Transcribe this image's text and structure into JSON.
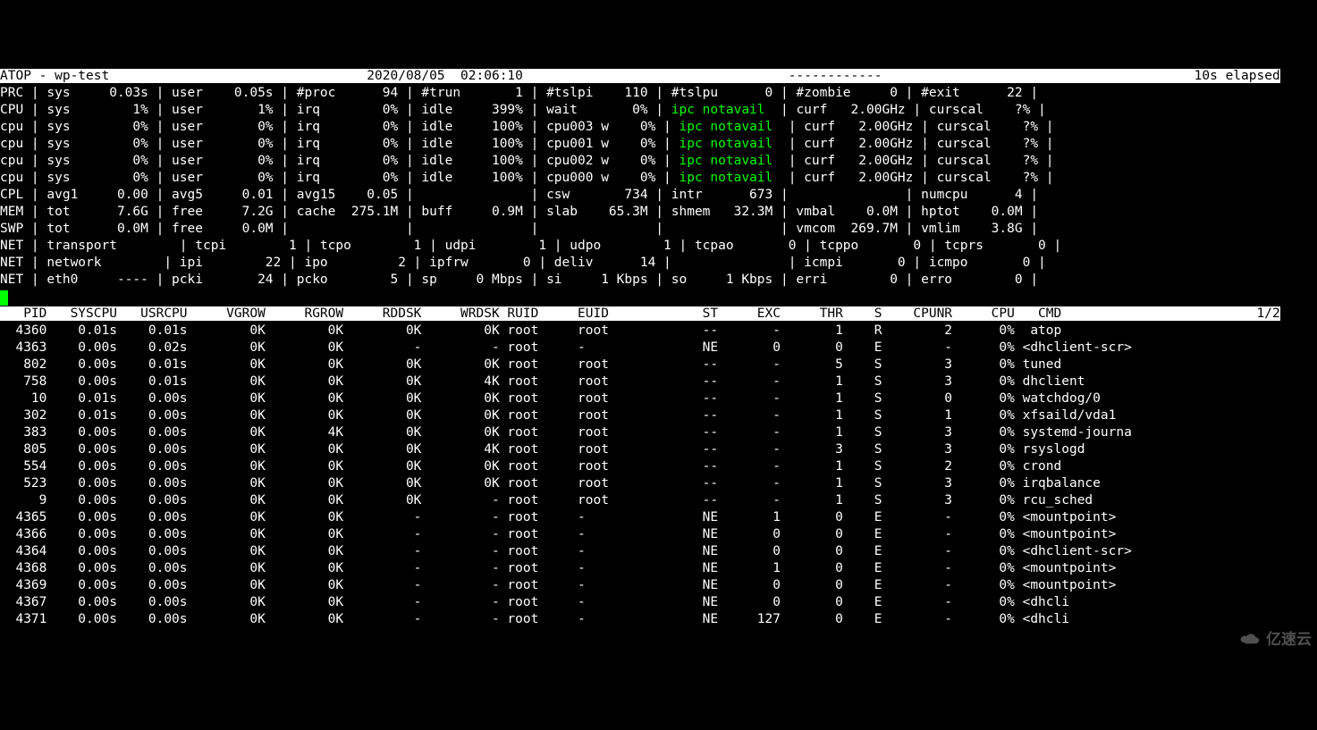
{
  "header": {
    "app": "ATOP",
    "host": "wp-test",
    "date": "2020/08/05",
    "time": "02:06:10",
    "dashes": "------------",
    "elapsed": "10s elapsed"
  },
  "sys_rows": [
    {
      "tag": "PRC",
      "cells": [
        [
          "sys",
          "0.03s"
        ],
        [
          "user",
          "0.05s"
        ],
        [
          "#proc",
          "94"
        ],
        [
          "#trun",
          "1"
        ],
        [
          "#tslpi",
          "110"
        ],
        [
          "#tslpu",
          "0"
        ],
        [
          "#zombie",
          "0"
        ],
        [
          "#exit",
          "22"
        ]
      ]
    },
    {
      "tag": "CPU",
      "cells": [
        [
          "sys",
          "1%"
        ],
        [
          "user",
          "1%"
        ],
        [
          "irq",
          "0%"
        ],
        [
          "idle",
          "399%"
        ],
        [
          "wait",
          "0%"
        ],
        [
          "ipc notavail",
          "",
          "grn"
        ],
        [
          "curf",
          "2.00GHz"
        ],
        [
          "curscal",
          "?%"
        ]
      ]
    },
    {
      "tag": "cpu",
      "cells": [
        [
          "sys",
          "0%"
        ],
        [
          "user",
          "0%"
        ],
        [
          "irq",
          "0%"
        ],
        [
          "idle",
          "100%"
        ],
        [
          "cpu003 w",
          "0%"
        ],
        [
          "ipc notavail",
          "",
          "grn"
        ],
        [
          "curf",
          "2.00GHz"
        ],
        [
          "curscal",
          "?%"
        ]
      ]
    },
    {
      "tag": "cpu",
      "cells": [
        [
          "sys",
          "0%"
        ],
        [
          "user",
          "0%"
        ],
        [
          "irq",
          "0%"
        ],
        [
          "idle",
          "100%"
        ],
        [
          "cpu001 w",
          "0%"
        ],
        [
          "ipc notavail",
          "",
          "grn"
        ],
        [
          "curf",
          "2.00GHz"
        ],
        [
          "curscal",
          "?%"
        ]
      ]
    },
    {
      "tag": "cpu",
      "cells": [
        [
          "sys",
          "0%"
        ],
        [
          "user",
          "0%"
        ],
        [
          "irq",
          "0%"
        ],
        [
          "idle",
          "100%"
        ],
        [
          "cpu002 w",
          "0%"
        ],
        [
          "ipc notavail",
          "",
          "grn"
        ],
        [
          "curf",
          "2.00GHz"
        ],
        [
          "curscal",
          "?%"
        ]
      ]
    },
    {
      "tag": "cpu",
      "cells": [
        [
          "sys",
          "0%"
        ],
        [
          "user",
          "0%"
        ],
        [
          "irq",
          "0%"
        ],
        [
          "idle",
          "100%"
        ],
        [
          "cpu000 w",
          "0%"
        ],
        [
          "ipc notavail",
          "",
          "grn"
        ],
        [
          "curf",
          "2.00GHz"
        ],
        [
          "curscal",
          "?%"
        ]
      ]
    },
    {
      "tag": "CPL",
      "cells": [
        [
          "avg1",
          "0.00"
        ],
        [
          "avg5",
          "0.01"
        ],
        [
          "avg15",
          "0.05"
        ],
        [
          "",
          ""
        ],
        [
          "csw",
          "734"
        ],
        [
          "intr",
          "673"
        ],
        [
          "",
          ""
        ],
        [
          "numcpu",
          "4"
        ]
      ]
    },
    {
      "tag": "MEM",
      "cells": [
        [
          "tot",
          "7.6G"
        ],
        [
          "free",
          "7.2G"
        ],
        [
          "cache",
          "275.1M"
        ],
        [
          "buff",
          "0.9M"
        ],
        [
          "slab",
          "65.3M"
        ],
        [
          "shmem",
          "32.3M"
        ],
        [
          "vmbal",
          "0.0M"
        ],
        [
          "hptot",
          "0.0M"
        ]
      ]
    },
    {
      "tag": "SWP",
      "cells": [
        [
          "tot",
          "0.0M"
        ],
        [
          "free",
          "0.0M"
        ],
        [
          "",
          ""
        ],
        [
          "",
          ""
        ],
        [
          "",
          ""
        ],
        [
          "",
          ""
        ],
        [
          "vmcom",
          "269.7M"
        ],
        [
          "vmlim",
          "3.8G"
        ]
      ]
    },
    {
      "tag": "NET",
      "cells": [
        [
          "transport",
          ""
        ],
        [
          "tcpi",
          "1"
        ],
        [
          "tcpo",
          "1"
        ],
        [
          "udpi",
          "1"
        ],
        [
          "udpo",
          "1"
        ],
        [
          "tcpao",
          "0"
        ],
        [
          "tcppo",
          "0"
        ],
        [
          "tcprs",
          "0"
        ]
      ]
    },
    {
      "tag": "NET",
      "cells": [
        [
          "network",
          ""
        ],
        [
          "ipi",
          "22"
        ],
        [
          "ipo",
          "2"
        ],
        [
          "ipfrw",
          "0"
        ],
        [
          "deliv",
          "14"
        ],
        [
          "",
          ""
        ],
        [
          "icmpi",
          "0"
        ],
        [
          "icmpo",
          "0"
        ]
      ]
    },
    {
      "tag": "NET",
      "cells": [
        [
          "eth0",
          "----"
        ],
        [
          "pcki",
          "24"
        ],
        [
          "pcko",
          "5"
        ],
        [
          "sp",
          "0 Mbps"
        ],
        [
          "si",
          "1 Kbps"
        ],
        [
          "so",
          "1 Kbps"
        ],
        [
          "erri",
          "0"
        ],
        [
          "erro",
          "0"
        ]
      ]
    }
  ],
  "proc_header": [
    "PID",
    "SYSCPU",
    "USRCPU",
    "VGROW",
    "RGROW",
    "RDDSK",
    "WRDSK",
    "RUID",
    "EUID",
    "ST",
    "EXC",
    "THR",
    "S",
    "CPUNR",
    "CPU",
    "CMD"
  ],
  "page": "1/2",
  "procs": [
    [
      "4360",
      "0.01s",
      "0.01s",
      "0K",
      "0K",
      "0K",
      "0K",
      "root",
      "root",
      "--",
      "-",
      "1",
      "R",
      "2",
      "0%",
      "atop"
    ],
    [
      "4363",
      "0.00s",
      "0.02s",
      "0K",
      "0K",
      "-",
      "-",
      "root",
      "-",
      "NE",
      "0",
      "0",
      "E",
      "-",
      "0%",
      "<dhclient-scr>"
    ],
    [
      "802",
      "0.00s",
      "0.01s",
      "0K",
      "0K",
      "0K",
      "0K",
      "root",
      "root",
      "--",
      "-",
      "5",
      "S",
      "3",
      "0%",
      "tuned"
    ],
    [
      "758",
      "0.00s",
      "0.01s",
      "0K",
      "0K",
      "0K",
      "4K",
      "root",
      "root",
      "--",
      "-",
      "1",
      "S",
      "3",
      "0%",
      "dhclient"
    ],
    [
      "10",
      "0.01s",
      "0.00s",
      "0K",
      "0K",
      "0K",
      "0K",
      "root",
      "root",
      "--",
      "-",
      "1",
      "S",
      "0",
      "0%",
      "watchdog/0"
    ],
    [
      "302",
      "0.01s",
      "0.00s",
      "0K",
      "0K",
      "0K",
      "0K",
      "root",
      "root",
      "--",
      "-",
      "1",
      "S",
      "1",
      "0%",
      "xfsaild/vda1"
    ],
    [
      "383",
      "0.00s",
      "0.00s",
      "0K",
      "4K",
      "0K",
      "0K",
      "root",
      "root",
      "--",
      "-",
      "1",
      "S",
      "3",
      "0%",
      "systemd-journa"
    ],
    [
      "805",
      "0.00s",
      "0.00s",
      "0K",
      "0K",
      "0K",
      "4K",
      "root",
      "root",
      "--",
      "-",
      "3",
      "S",
      "3",
      "0%",
      "rsyslogd"
    ],
    [
      "554",
      "0.00s",
      "0.00s",
      "0K",
      "0K",
      "0K",
      "0K",
      "root",
      "root",
      "--",
      "-",
      "1",
      "S",
      "2",
      "0%",
      "crond"
    ],
    [
      "523",
      "0.00s",
      "0.00s",
      "0K",
      "0K",
      "0K",
      "0K",
      "root",
      "root",
      "--",
      "-",
      "1",
      "S",
      "3",
      "0%",
      "irqbalance"
    ],
    [
      "9",
      "0.00s",
      "0.00s",
      "0K",
      "0K",
      "0K",
      "-",
      "root",
      "root",
      "--",
      "-",
      "1",
      "S",
      "3",
      "0%",
      "rcu_sched"
    ],
    [
      "4365",
      "0.00s",
      "0.00s",
      "0K",
      "0K",
      "-",
      "-",
      "root",
      "-",
      "NE",
      "1",
      "0",
      "E",
      "-",
      "0%",
      "<mountpoint>"
    ],
    [
      "4366",
      "0.00s",
      "0.00s",
      "0K",
      "0K",
      "-",
      "-",
      "root",
      "-",
      "NE",
      "0",
      "0",
      "E",
      "-",
      "0%",
      "<mountpoint>"
    ],
    [
      "4364",
      "0.00s",
      "0.00s",
      "0K",
      "0K",
      "-",
      "-",
      "root",
      "-",
      "NE",
      "0",
      "0",
      "E",
      "-",
      "0%",
      "<dhclient-scr>"
    ],
    [
      "4368",
      "0.00s",
      "0.00s",
      "0K",
      "0K",
      "-",
      "-",
      "root",
      "-",
      "NE",
      "1",
      "0",
      "E",
      "-",
      "0%",
      "<mountpoint>"
    ],
    [
      "4369",
      "0.00s",
      "0.00s",
      "0K",
      "0K",
      "-",
      "-",
      "root",
      "-",
      "NE",
      "0",
      "0",
      "E",
      "-",
      "0%",
      "<mountpoint>"
    ],
    [
      "4367",
      "0.00s",
      "0.00s",
      "0K",
      "0K",
      "-",
      "-",
      "root",
      "-",
      "NE",
      "0",
      "0",
      "E",
      "-",
      "0%",
      "<dhcli"
    ],
    [
      "4371",
      "0.00s",
      "0.00s",
      "0K",
      "0K",
      "-",
      "-",
      "root",
      "-",
      "NE",
      "127",
      "0",
      "E",
      "-",
      "0%",
      "<dhcli"
    ]
  ],
  "watermark": "亿速云"
}
